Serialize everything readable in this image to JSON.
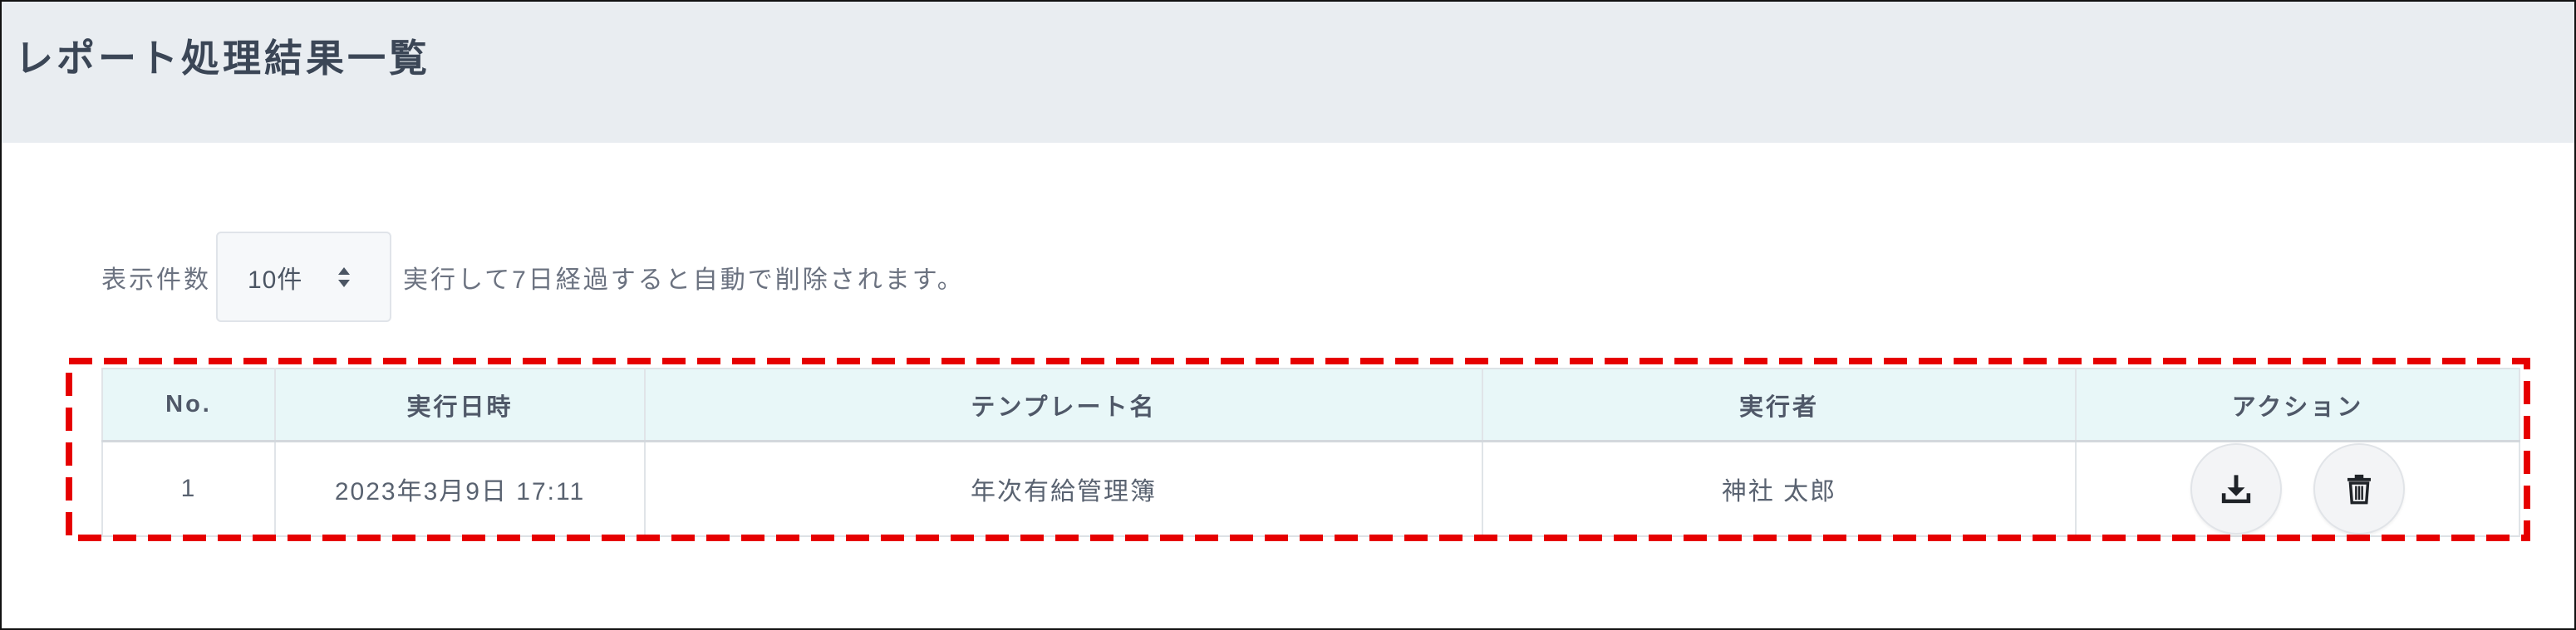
{
  "page": {
    "title": "レポート処理結果一覧"
  },
  "controls": {
    "display_count_label": "表示件数",
    "display_count_value": "10件",
    "note": "実行して7日経過すると自動で削除されます。"
  },
  "table": {
    "columns": [
      "No.",
      "実行日時",
      "テンプレート名",
      "実行者",
      "アクション"
    ],
    "rows": [
      {
        "no": "1",
        "executed_at": "2023年3月9日 17:11",
        "template": "年次有給管理簿",
        "executor": "神社 太郎",
        "actions": [
          "download-icon",
          "trash-icon"
        ]
      }
    ]
  },
  "icons": {
    "select": "sort-arrows-icon",
    "download": "download-icon",
    "delete": "trash-icon"
  },
  "colors": {
    "header_bg": "#e9edf1",
    "table_header_bg": "#e8f7f8",
    "highlight": "#e60000",
    "title": "#3b4656"
  }
}
